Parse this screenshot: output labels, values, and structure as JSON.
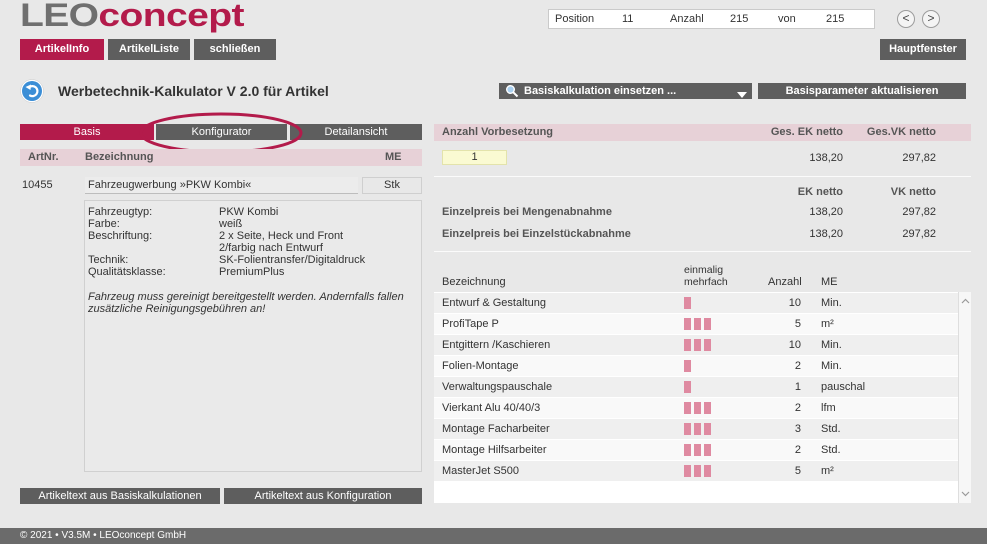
{
  "header": {
    "logo": {
      "part1": "LEO",
      "part2": "concept"
    },
    "record_nav": {
      "position_label": "Position",
      "position_value": "11",
      "count_label": "Anzahl",
      "count_value": "215",
      "of_label": "von",
      "of_value": "215"
    },
    "prev_button": "<",
    "next_button": ">",
    "tabs": [
      {
        "label": "ArtikelInfo",
        "active": true
      },
      {
        "label": "ArtikelListe",
        "active": false
      },
      {
        "label": "schließen",
        "active": false
      }
    ],
    "main_window_button": "Hauptfenster"
  },
  "title_bar": {
    "back_icon": "back-arrow-icon",
    "title": "Werbetechnik-Kalkulator V 2.0 für Artikel",
    "calc_dropdown": {
      "icon": "search-icon",
      "value": "Basiskalkulation einsetzen ..."
    },
    "update_button": "Basisparameter aktualisieren"
  },
  "article_panel": {
    "tabs": [
      {
        "label": "Basis",
        "active": true
      },
      {
        "label": "Konfigurator",
        "active": false
      },
      {
        "label": "Detailansicht",
        "active": false
      }
    ],
    "columns": {
      "artnr": "ArtNr.",
      "name": "Bezeichnung",
      "unit": "ME"
    },
    "article": {
      "artnr": "10455",
      "name": "Fahrzeugwerbung »PKW Kombi«",
      "unit": "Stk"
    },
    "attributes": [
      {
        "label": "Fahrzeugtyp:",
        "value": "PKW Kombi"
      },
      {
        "label": "Farbe:",
        "value": "weiß"
      },
      {
        "label": "Beschriftung:",
        "value": "2 x Seite, Heck und Front"
      },
      {
        "label": "",
        "value": "2/farbig nach Entwurf"
      },
      {
        "label": "Technik:",
        "value": "SK-Folientransfer/Digitaldruck"
      },
      {
        "label": "Qualitätsklasse:",
        "value": "PremiumPlus"
      }
    ],
    "note": "Fahrzeug muss gereinigt bereitgestellt werden. Andernfalls fallen zusätzliche Reinigungsgebühren an!",
    "buttons": {
      "from_base": "Artikeltext aus Basiskalkulationen",
      "from_config": "Artikeltext aus Konfiguration"
    }
  },
  "pricing_panel": {
    "header": {
      "quantity": "Anzahl Vorbesetzung",
      "total_ek": "Ges. EK netto",
      "total_vk": "Ges.VK netto"
    },
    "quantity_value": "1",
    "total_ek_value": "138,20",
    "total_vk_value": "297,82",
    "unit_header": {
      "ek": "EK netto",
      "vk": "VK netto"
    },
    "unit_prices": [
      {
        "label": "Einzelpreis bei Mengenabnahme",
        "ek": "138,20",
        "vk": "297,82"
      },
      {
        "label": "Einzelpreis bei Einzelstückabnahme",
        "ek": "138,20",
        "vk": "297,82"
      }
    ],
    "items_header": {
      "name": "Bezeichnung",
      "once": "einmalig",
      "multiple": "mehrfach",
      "count": "Anzahl",
      "unit": "ME"
    },
    "items": [
      {
        "name": "Entwurf & Gestaltung",
        "bars": 1,
        "count": "10",
        "unit": "Min."
      },
      {
        "name": "ProfiTape P",
        "bars": 3,
        "count": "5",
        "unit": "m²"
      },
      {
        "name": "Entgittern /Kaschieren",
        "bars": 3,
        "count": "10",
        "unit": "Min."
      },
      {
        "name": "Folien-Montage",
        "bars": 1,
        "count": "2",
        "unit": "Min."
      },
      {
        "name": "Verwaltungspauschale",
        "bars": 1,
        "count": "1",
        "unit": "pauschal"
      },
      {
        "name": "Vierkant Alu 40/40/3",
        "bars": 3,
        "count": "2",
        "unit": "lfm"
      },
      {
        "name": "Montage Facharbeiter",
        "bars": 3,
        "count": "3",
        "unit": "Std."
      },
      {
        "name": "Montage Hilfsarbeiter",
        "bars": 3,
        "count": "2",
        "unit": "Std."
      },
      {
        "name": "MasterJet S500",
        "bars": 3,
        "count": "5",
        "unit": "m²"
      }
    ]
  },
  "footer": {
    "text": "© 2021 • V3.5M • LEOconcept GmbH"
  },
  "colors": {
    "accent": "#b31b4b",
    "button": "#5e5e5e",
    "header_bg": "#e7d1d7",
    "bar": "#df8aa1",
    "input_bg": "#fafad2"
  }
}
